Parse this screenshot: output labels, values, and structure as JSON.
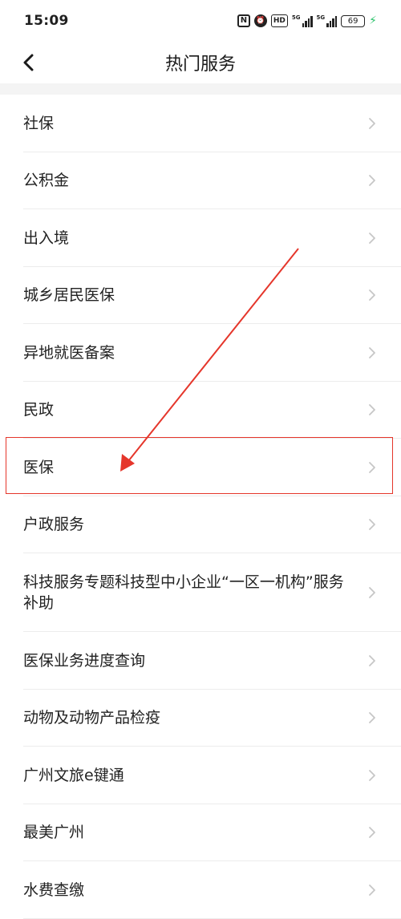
{
  "status_bar": {
    "time": "15:09",
    "nfc": "N",
    "hd": "HD",
    "net_1": "5G",
    "net_2": "5G",
    "battery": "69"
  },
  "nav": {
    "back_icon": "chevron-left-icon",
    "title": "热门服务"
  },
  "services": [
    {
      "label": "社保"
    },
    {
      "label": "公积金"
    },
    {
      "label": "出入境"
    },
    {
      "label": "城乡居民医保"
    },
    {
      "label": "异地就医备案"
    },
    {
      "label": "民政"
    },
    {
      "label": "医保"
    },
    {
      "label": "户政服务"
    },
    {
      "label": "科技服务专题科技型中小企业“一区一机构”服务补助"
    },
    {
      "label": "医保业务进度查询"
    },
    {
      "label": "动物及动物产品检疫"
    },
    {
      "label": "广州文旅e键通"
    },
    {
      "label": "最美广州"
    },
    {
      "label": "水费查缴"
    }
  ],
  "annotation": {
    "color": "#e5362b",
    "highlighted_item": "医保"
  },
  "colors": {
    "background": "#ffffff",
    "divider": "#ececec",
    "section_gap": "#f4f4f4",
    "chevron": "#c6c6c6",
    "charging": "#2bc26b"
  }
}
